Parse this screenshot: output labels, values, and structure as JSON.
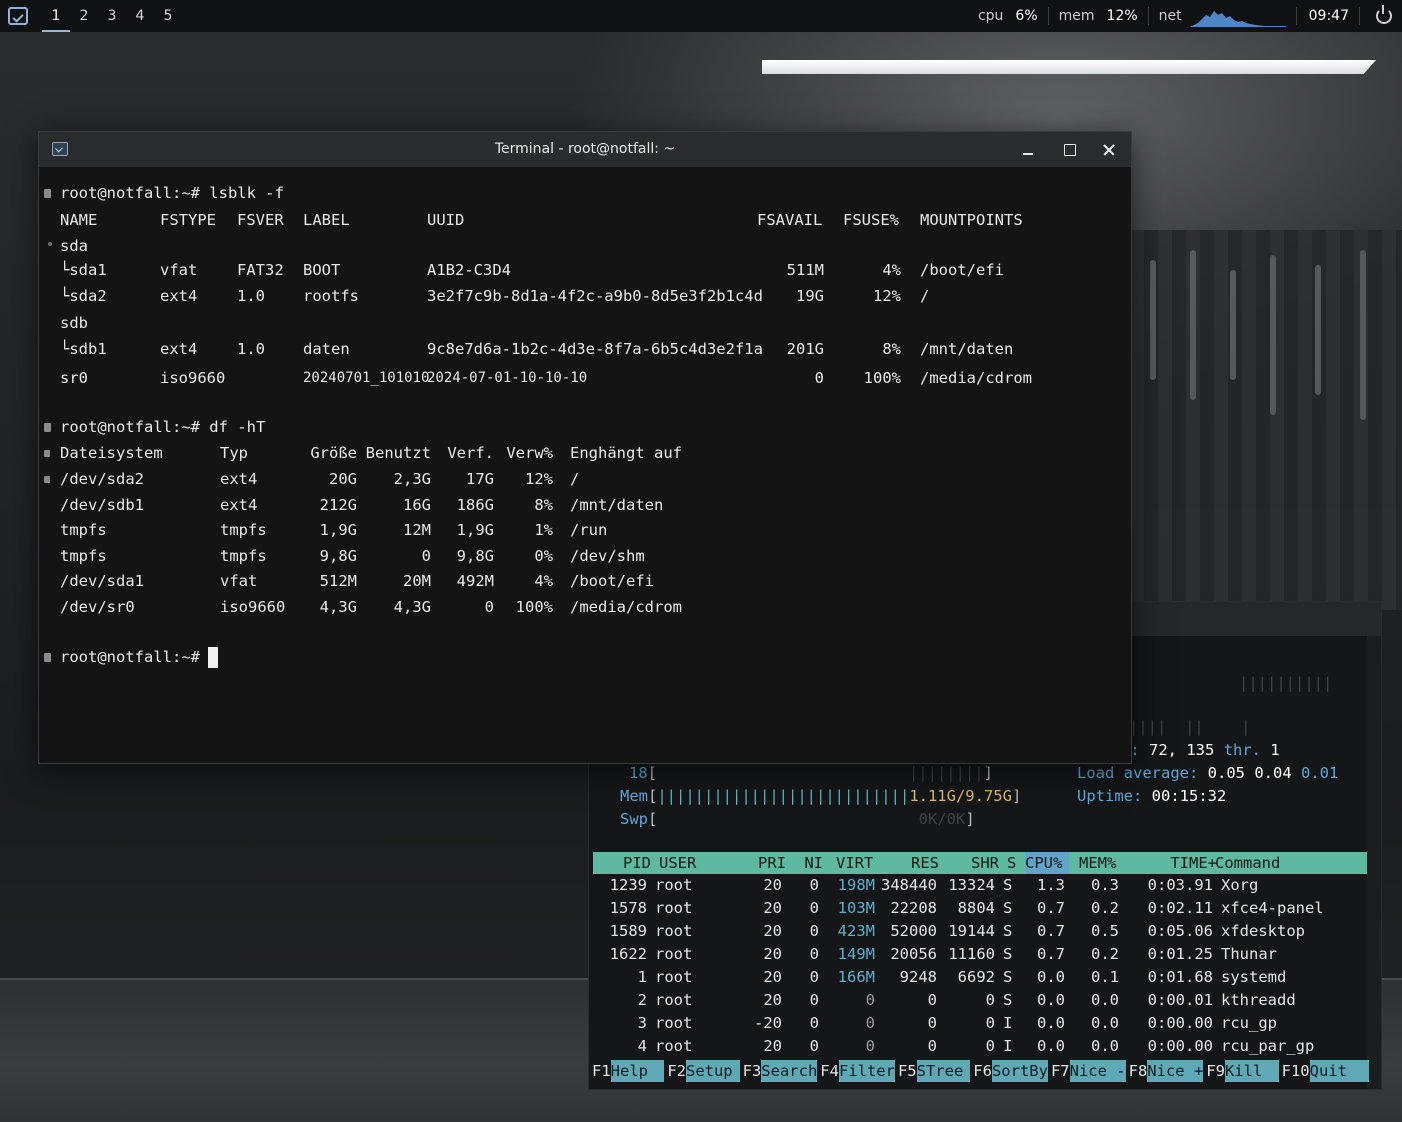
{
  "panel": {
    "workspaces": [
      "1",
      "2",
      "3",
      "4",
      "5"
    ],
    "cpu_label": "cpu",
    "cpu_value": "6%",
    "mem_label": "mem",
    "mem_value": "12%",
    "net_label": "net",
    "clock": "09:47",
    "icons": [
      "menu-icon",
      "network-graph",
      "power-icon"
    ]
  },
  "terminal": {
    "title": "Terminal - root@notfall: ~",
    "lsblk": {
      "prompt": "root@notfall:~# lsblk -f",
      "headers": [
        "NAME",
        "FSTYPE",
        "FSVER",
        "LABEL",
        "UUID",
        "FSAVAIL",
        "FSUSE%",
        "MOUNTPOINTS"
      ],
      "rows": [
        [
          "sda",
          "",
          "",
          "",
          "",
          "",
          "",
          ""
        ],
        [
          "└sda1",
          "vfat",
          "FAT32",
          "BOOT",
          "A1B2-C3D4",
          "511M",
          "4%",
          "/boot/efi"
        ],
        [
          "└sda2",
          "ext4",
          "1.0",
          "rootfs",
          "3e2f7c9b-8d1a-4f2c-a9b0-8d5e3f2b1c4d",
          "19G",
          "12%",
          "/"
        ],
        [
          "sdb",
          "",
          "",
          "",
          "",
          "",
          "",
          ""
        ],
        [
          "└sdb1",
          "ext4",
          "1.0",
          "daten",
          "9c8e7d6a-1b2c-4d3e-8f7a-6b5c4d3e2f1a",
          "201G",
          "8%",
          "/mnt/daten"
        ],
        [
          "sr0",
          "iso9660",
          "",
          "20240701_101010",
          "2024-07-01-10-10-10",
          "0",
          "100%",
          "/media/cdrom"
        ]
      ]
    },
    "df": {
      "prompt": "root@notfall:~# df -hT",
      "headers": [
        "Dateisystem",
        "Typ",
        "Größe",
        "Benutzt",
        "Verf.",
        "Verw%",
        "Enghängt auf"
      ],
      "rows": [
        [
          "/dev/sda2",
          "ext4",
          "20G",
          "2,3G",
          "17G",
          "12%",
          "/"
        ],
        [
          "/dev/sdb1",
          "ext4",
          "212G",
          "16G",
          "186G",
          "8%",
          "/mnt/daten"
        ],
        [
          "tmpfs",
          "tmpfs",
          "1,9G",
          "12M",
          "1,9G",
          "1%",
          "/run"
        ],
        [
          "tmpfs",
          "tmpfs",
          "9,8G",
          "0",
          "9,8G",
          "0%",
          "/dev/shm"
        ],
        [
          "/dev/sda1",
          "vfat",
          "512M",
          "20M",
          "492M",
          "4%",
          "/boot/efi"
        ],
        [
          "/dev/sr0",
          "iso9660",
          "4,3G",
          "4,3G",
          "0",
          "100%",
          "/media/cdrom"
        ]
      ]
    },
    "final_prompt": "root@notfall:~#"
  },
  "htop": {
    "tasks_label": "s:",
    "tasks_value": "72, 135",
    "thr_label": "thr.",
    "thr_value": "1",
    "cpu_row_label": "18",
    "mem_label": "Mem",
    "mem_value": "1.11G/9.75G",
    "swp_label": "Swp",
    "swp_value": "0K/0K",
    "load_label": "Load average:",
    "load1": "0.05",
    "load5": "0.04",
    "load15": "0.01",
    "uptime_label": "Uptime:",
    "uptime_value": "00:15:32",
    "columns": [
      "PID",
      "USER",
      "PRI",
      "NI",
      "VIRT",
      "RES",
      "SHR",
      "S",
      "CPU%",
      "MEM%",
      "TIME+",
      "Command"
    ],
    "sort_column": "CPU%",
    "processes": [
      [
        "1239",
        "root",
        "20",
        "0",
        "198M",
        "348440",
        "13324",
        "S",
        "1.3",
        "0.3",
        "0:03.91",
        "Xorg"
      ],
      [
        "1578",
        "root",
        "20",
        "0",
        "103M",
        "22208",
        "8804",
        "S",
        "0.7",
        "0.2",
        "0:02.11",
        "xfce4-panel"
      ],
      [
        "1589",
        "root",
        "20",
        "0",
        "423M",
        "52000",
        "19144",
        "S",
        "0.7",
        "0.5",
        "0:05.06",
        "xfdesktop"
      ],
      [
        "1622",
        "root",
        "20",
        "0",
        "149M",
        "20056",
        "11160",
        "S",
        "0.7",
        "0.2",
        "0:01.25",
        "Thunar"
      ],
      [
        "1",
        "root",
        "20",
        "0",
        "166M",
        "9248",
        "6692",
        "S",
        "0.0",
        "0.1",
        "0:01.68",
        "systemd"
      ],
      [
        "2",
        "root",
        "20",
        "0",
        "0",
        "0",
        "0",
        "S",
        "0.0",
        "0.0",
        "0:00.01",
        "kthreadd"
      ],
      [
        "3",
        "root",
        "-20",
        "0",
        "0",
        "0",
        "0",
        "I",
        "0.0",
        "0.0",
        "0:00.00",
        "rcu_gp"
      ],
      [
        "4",
        "root",
        "20",
        "0",
        "0",
        "0",
        "0",
        "I",
        "0.0",
        "0.0",
        "0:00.00",
        "rcu_par_gp"
      ]
    ],
    "fkeys": [
      {
        "key": "F1",
        "label": "Help"
      },
      {
        "key": "F2",
        "label": "Setup"
      },
      {
        "key": "F3",
        "label": "Search"
      },
      {
        "key": "F4",
        "label": "Filter"
      },
      {
        "key": "F5",
        "label": "STree"
      },
      {
        "key": "F6",
        "label": "SortBy"
      },
      {
        "key": "F7",
        "label": "Nice -"
      },
      {
        "key": "F8",
        "label": "Nice +"
      },
      {
        "key": "F9",
        "label": "Kill"
      },
      {
        "key": "F10",
        "label": "Quit"
      }
    ]
  }
}
